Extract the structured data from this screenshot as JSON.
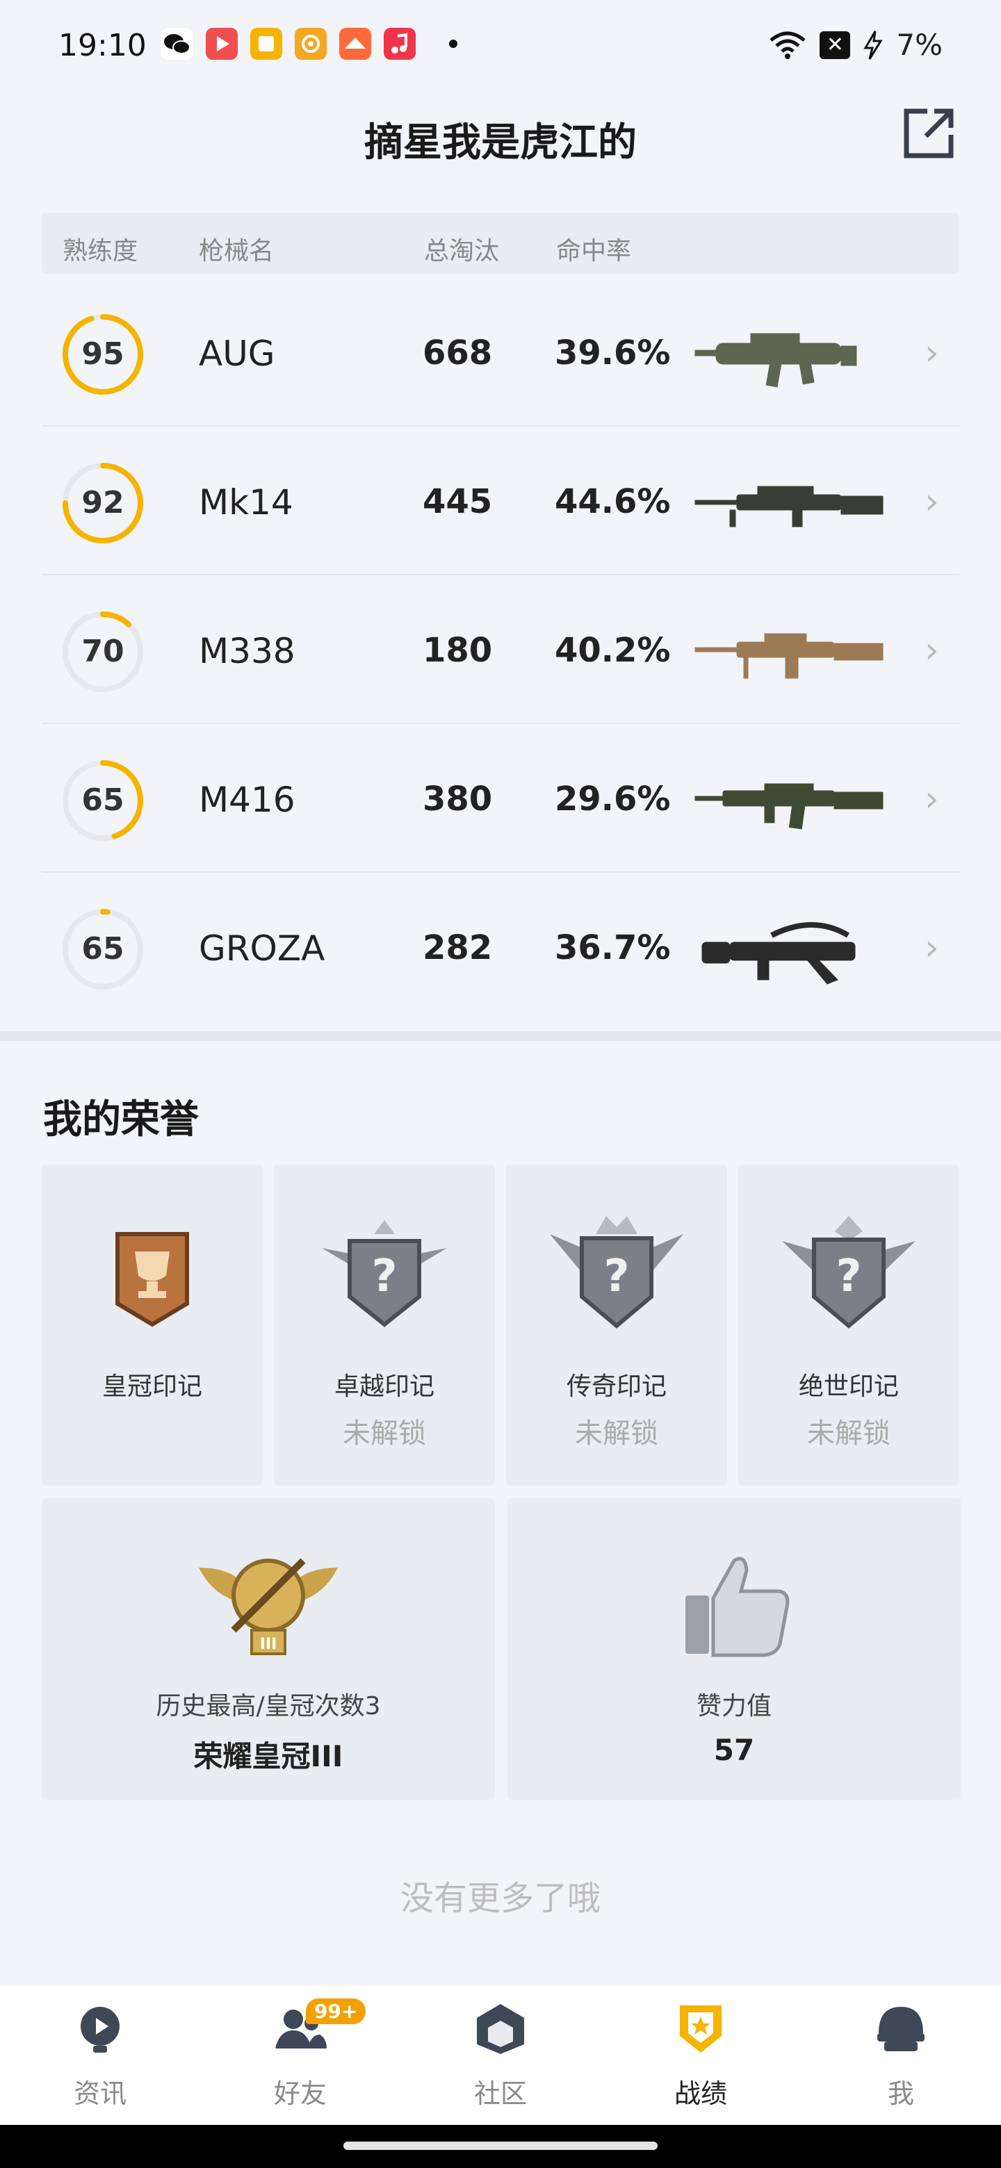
{
  "status_bar": {
    "time": "19:10",
    "battery": "7%",
    "app_colors": [
      "#2bb24c",
      "#ef4f4f",
      "#f5b300",
      "#f5a623",
      "#ff6a3d",
      "#f0344b"
    ]
  },
  "header": {
    "title": "摘星我是虎江的"
  },
  "table": {
    "columns": [
      "熟练度",
      "枪械名",
      "总淘汰",
      "命中率"
    ],
    "rows": [
      {
        "proficiency": "95",
        "progress": 0.95,
        "name": "AUG",
        "kills": "668",
        "accuracy": "39.6%",
        "gun_color": "#5c6650"
      },
      {
        "proficiency": "92",
        "progress": 0.75,
        "name": "Mk14",
        "kills": "445",
        "accuracy": "44.6%",
        "gun_color": "#3a3d35"
      },
      {
        "proficiency": "70",
        "progress": 0.12,
        "name": "M338",
        "kills": "180",
        "accuracy": "40.2%",
        "gun_color": "#9b7a55"
      },
      {
        "proficiency": "65",
        "progress": 0.45,
        "name": "M416",
        "kills": "380",
        "accuracy": "29.6%",
        "gun_color": "#3f4a35"
      },
      {
        "proficiency": "65",
        "progress": 0.02,
        "name": "GROZA",
        "kills": "282",
        "accuracy": "36.7%",
        "gun_color": "#2b2b2b"
      }
    ],
    "accent_color": "#f4b400"
  },
  "honors": {
    "title": "我的荣誉",
    "badges": [
      {
        "name": "皇冠印记",
        "status": "",
        "icon": "crown-trophy-icon"
      },
      {
        "name": "卓越印记",
        "status": "未解锁",
        "icon": "locked-badge-icon"
      },
      {
        "name": "传奇印记",
        "status": "未解锁",
        "icon": "locked-badge-icon"
      },
      {
        "name": "绝世印记",
        "status": "未解锁",
        "icon": "locked-badge-icon"
      }
    ],
    "rank_card": {
      "sub": "历史最高/皇冠次数3",
      "main": "荣耀皇冠III",
      "icon": "crown-rank-icon"
    },
    "likes_card": {
      "sub": "赞力值",
      "main": "57",
      "icon": "thumbs-up-icon"
    }
  },
  "footer": {
    "no_more": "没有更多了哦"
  },
  "bottom_nav": {
    "items": [
      {
        "label": "资讯",
        "icon": "news-icon",
        "active": false
      },
      {
        "label": "好友",
        "icon": "friends-icon",
        "active": false,
        "badge": "99+"
      },
      {
        "label": "社区",
        "icon": "community-icon",
        "active": false
      },
      {
        "label": "战绩",
        "icon": "record-icon",
        "active": true
      },
      {
        "label": "我",
        "icon": "profile-icon",
        "active": false
      }
    ]
  }
}
